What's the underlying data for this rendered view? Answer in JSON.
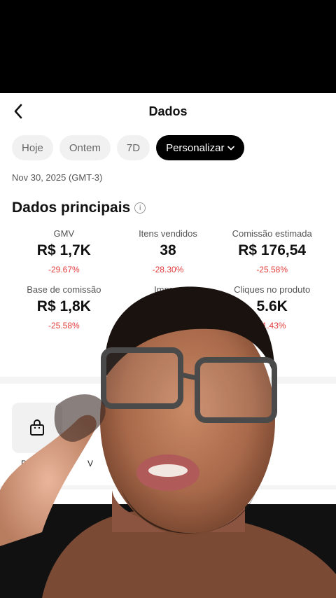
{
  "header": {
    "title": "Dados",
    "back_icon": "chevron-left-icon"
  },
  "filters": {
    "chips": [
      {
        "label": "Hoje"
      },
      {
        "label": "Ontem"
      },
      {
        "label": "7D"
      },
      {
        "label": "Personalizar",
        "active": true,
        "icon": "chevron-down-icon"
      }
    ]
  },
  "date_range": "Nov 30, 2025 (GMT-3)",
  "main_data": {
    "title": "Dados principais",
    "info_icon": "info-icon",
    "metrics": [
      {
        "label": "GMV",
        "value": "R$ 1,7K",
        "delta": "-29.67%"
      },
      {
        "label": "Itens vendidos",
        "value": "38",
        "delta": "-28.30%"
      },
      {
        "label": "Comissão estimada",
        "value": "R$ 176,54",
        "delta": "-25.58%"
      },
      {
        "label": "Base de comissão",
        "value": "R$ 1,8K",
        "delta": "-25.58%"
      },
      {
        "label": "Impres",
        "value": "",
        "delta": ""
      },
      {
        "label": "Cliques no produto",
        "value": "5.6K",
        "delta": "11.43%"
      }
    ]
  },
  "shortcuts": {
    "items": [
      {
        "label": "P",
        "icon": "shopping-bag-icon"
      },
      {
        "label": "V",
        "icon": ""
      }
    ]
  },
  "colors": {
    "negative": "#e23b3b",
    "chip_active_bg": "#000000",
    "chip_bg": "#f1f1f2"
  }
}
